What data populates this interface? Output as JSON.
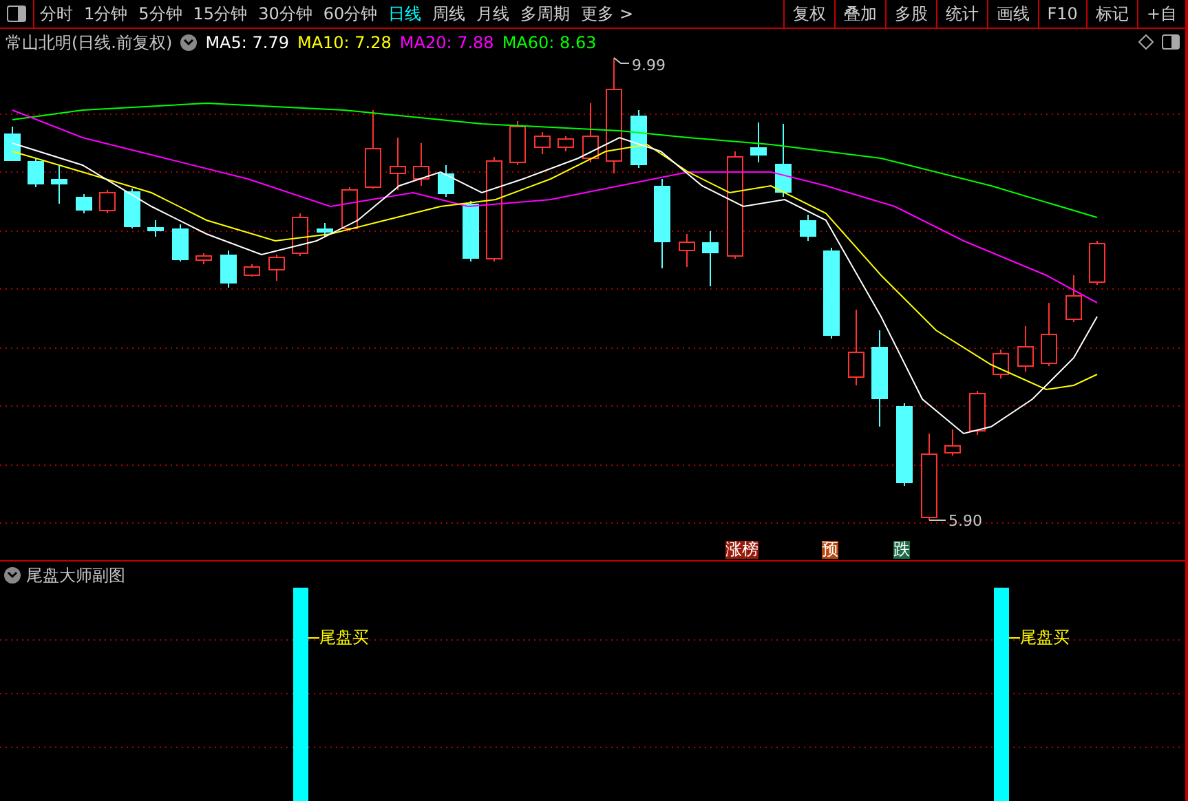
{
  "toolbar": {
    "tabs": [
      {
        "label": "分时",
        "selected": false
      },
      {
        "label": "1分钟",
        "selected": false
      },
      {
        "label": "5分钟",
        "selected": false
      },
      {
        "label": "15分钟",
        "selected": false
      },
      {
        "label": "30分钟",
        "selected": false
      },
      {
        "label": "60分钟",
        "selected": false
      },
      {
        "label": "日线",
        "selected": true
      },
      {
        "label": "周线",
        "selected": false
      },
      {
        "label": "月线",
        "selected": false
      },
      {
        "label": "多周期",
        "selected": false
      }
    ],
    "more": "更多 >",
    "buttons": [
      "复权",
      "叠加",
      "多股",
      "统计",
      "画线",
      "F10",
      "标记",
      "+自"
    ]
  },
  "main_chart": {
    "title": "常山北明(日线.前复权)",
    "moving_averages": [
      {
        "label": "MA5: 7.79",
        "color": "#ffffff"
      },
      {
        "label": "MA10: 7.28",
        "color": "#ffff00"
      },
      {
        "label": "MA20: 7.88",
        "color": "#ff00ff"
      },
      {
        "label": "MA60: 8.63",
        "color": "#00ff00"
      }
    ],
    "high_label": "9.99",
    "low_label": "5.90",
    "signal_tags": [
      {
        "label": "涨榜",
        "color": "#9a1a0a"
      },
      {
        "label": "预",
        "color": "#b8460c"
      },
      {
        "label": "跌",
        "color": "#1c6b45"
      }
    ]
  },
  "sub_chart": {
    "title": "尾盘大师副图",
    "signals": [
      "尾盘买",
      "尾盘买"
    ]
  }
}
